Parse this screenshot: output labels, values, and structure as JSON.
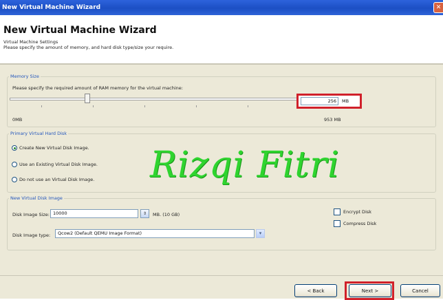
{
  "window": {
    "title": "New Virtual Machine Wizard",
    "close_glyph": "✕"
  },
  "header": {
    "title": "New Virtual Machine Wizard",
    "subtitle": "Virtual Machine Settings",
    "instructions": "Please specify the amount of memory, and hard disk type/size your require."
  },
  "memory": {
    "legend": "Memory Size",
    "prompt": "Please specify the required amount of RAM memory for the virtual machine:",
    "value": "256",
    "unit": "MB",
    "min_label": "0MB",
    "max_label": "953 MB",
    "slider_fraction": 0.27
  },
  "hard_disk": {
    "legend": "Primary Virtual Hard Disk",
    "options": [
      {
        "label": "Create New Virtual Disk Image.",
        "selected": true
      },
      {
        "label": "Use an  Existing Virtual Disk Image.",
        "selected": false
      },
      {
        "label": "Do not  use an Virtual Disk Image.",
        "selected": false
      }
    ]
  },
  "new_image": {
    "legend": "New Virtual Disk Image",
    "size_label": "Disk Image Size:",
    "size_value": "10000",
    "size_unit": "MB. (10 GB)",
    "type_label": "Disk Image type:",
    "type_value": "Qcow2  (Default QEMU Image Format)",
    "encrypt_label": "Encrypt Disk",
    "compress_label": "Compress Disk"
  },
  "watermark": "Rizqi Fitri",
  "buttons": {
    "back": "< Back",
    "next": "Next >",
    "cancel": "Cancel"
  },
  "colors": {
    "titlebar": "#1c4fc4",
    "highlight": "#d0202a",
    "watermark": "#2fd42f",
    "dialog_bg": "#ece9d8"
  }
}
